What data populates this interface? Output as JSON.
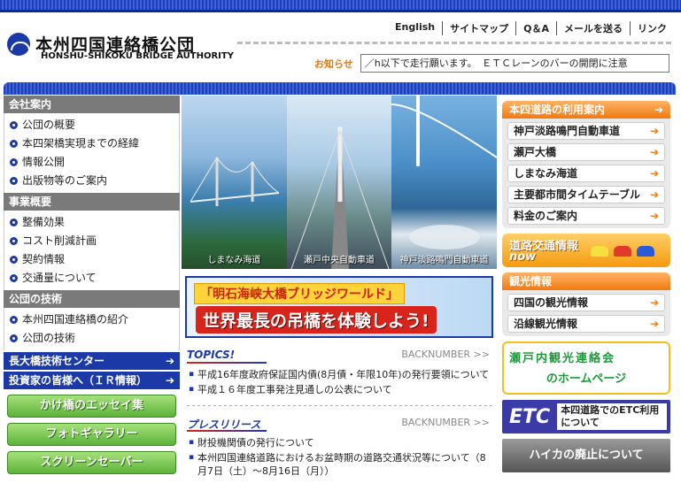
{
  "header": {
    "logo_jp": "本州四国連絡橋公団",
    "logo_en": "HONSHU-SHIKOKU BRIDGE AUTHORITY",
    "nav": [
      "English",
      "サイトマップ",
      "Q＆A",
      "メールを送る",
      "リンク"
    ],
    "news_label": "お知らせ",
    "news_text": "／h以下で走行願います。　ＥＴＣレーンのバーの開閉に注意"
  },
  "left": {
    "sections": [
      {
        "title": "会社案内",
        "items": [
          "公団の概要",
          "本四架橋実現までの経緯",
          "情報公開",
          "出版物等のご案内"
        ]
      },
      {
        "title": "事業概要",
        "items": [
          "整備効果",
          "コスト削減計画",
          "契約情報",
          "交通量について"
        ]
      },
      {
        "title": "公団の技術",
        "items": [
          "本州四国連絡橋の紹介",
          "公団の技術"
        ]
      }
    ],
    "navy_links": [
      "長大橋技術センター",
      "投資家の皆様へ（ＩＲ情報）"
    ],
    "green_buttons": [
      "かけ橋のエッセイ集",
      "フォトギャラリー",
      "スクリーンセーバー"
    ]
  },
  "photos": {
    "captions": [
      "しまなみ海道",
      "瀬戸中央自動車道",
      "神戸淡路鳴門自動車道"
    ]
  },
  "banner": {
    "line1": "「明石海峡大橋ブリッジワールド」",
    "line2": "世界最長の吊橋を体験しよう!"
  },
  "topics": {
    "title": "TOPICS!",
    "backnumber": "BACKNUMBER >>",
    "items": [
      "平成16年度政府保証国内債(8月債・年限10年)の発行要領について",
      "平成１６年度工事発注見通しの公表について"
    ]
  },
  "press": {
    "title": "プレスリリース",
    "backnumber": "BACKNUMBER >>",
    "items": [
      "財投機関債の発行について",
      "本州四国連絡道路におけるお盆時期の道路交通状況等について（8月7日（土）～8月16日（月））"
    ]
  },
  "right": {
    "usage": {
      "title": "本四道路の利用案内",
      "items": [
        "神戸淡路鳴門自動車道",
        "瀬戸大橋",
        "しまなみ海道",
        "主要都市間タイムテーブル",
        "料金のご案内"
      ]
    },
    "traffic": {
      "line1": "道路交通情報",
      "line2": "now"
    },
    "tourism": {
      "title": "観光情報",
      "items": [
        "四国の観光情報",
        "沿線観光情報"
      ]
    },
    "setouchi": {
      "line1": "瀬戸内観光連絡会",
      "line2": "のホームページ"
    },
    "etc": {
      "logo": "ETC",
      "text": "本四道路でのETC利用について"
    },
    "hiyaka": "ハイカの廃止について"
  },
  "colors": {
    "navy": "#1b3aa8",
    "orange": "#f07a10",
    "green": "#5cb33a"
  }
}
